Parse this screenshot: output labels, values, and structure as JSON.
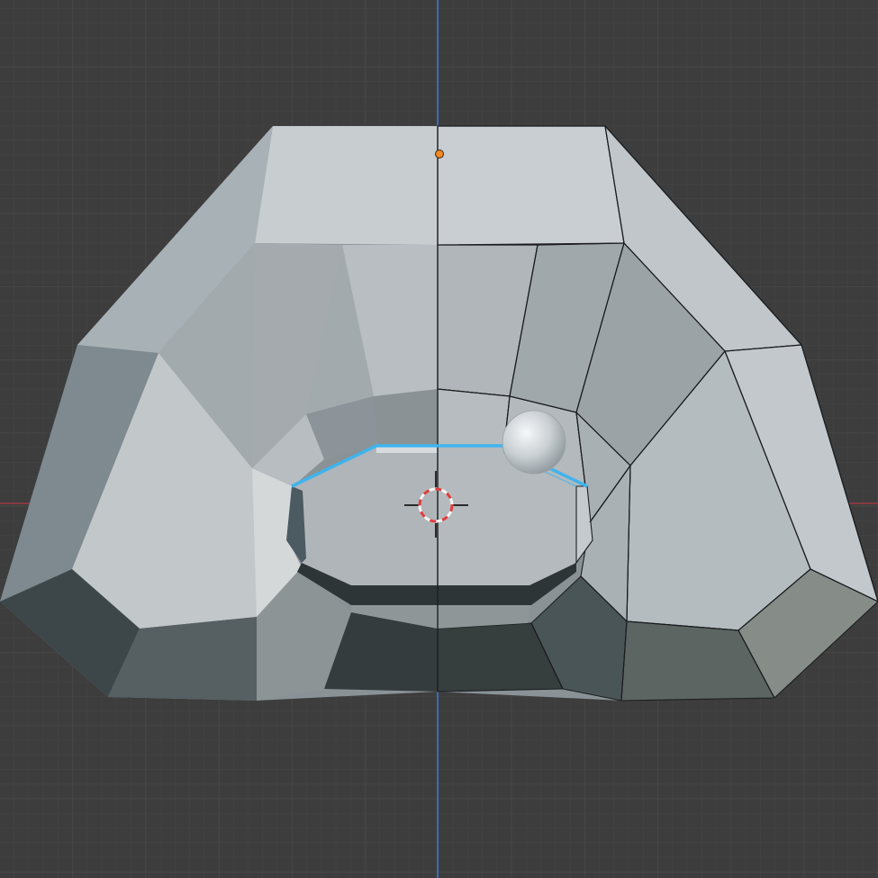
{
  "viewport": {
    "mode": "3d-viewport",
    "background_color": "#3d3d3d",
    "grid_minor_color": "#454545",
    "grid_major_color": "#4c4c4c",
    "axis_x_color": "#b23c46",
    "axis_z_color": "#3a6ec8"
  },
  "mesh": {
    "shading": "solid",
    "face_color_light": "#c6ccd0",
    "face_color_shadow": "#3b4446",
    "edge_color": "#1c1e20",
    "selected_edge_color": "#3fb4ee"
  },
  "object_origin_color": "#f08a24",
  "cursor_3d": {
    "ring_color_a": "#e03c3c",
    "ring_color_b": "#f4f4f4",
    "crosshair_color": "#222222"
  },
  "matcap_sphere_color": "#dfe3e6"
}
